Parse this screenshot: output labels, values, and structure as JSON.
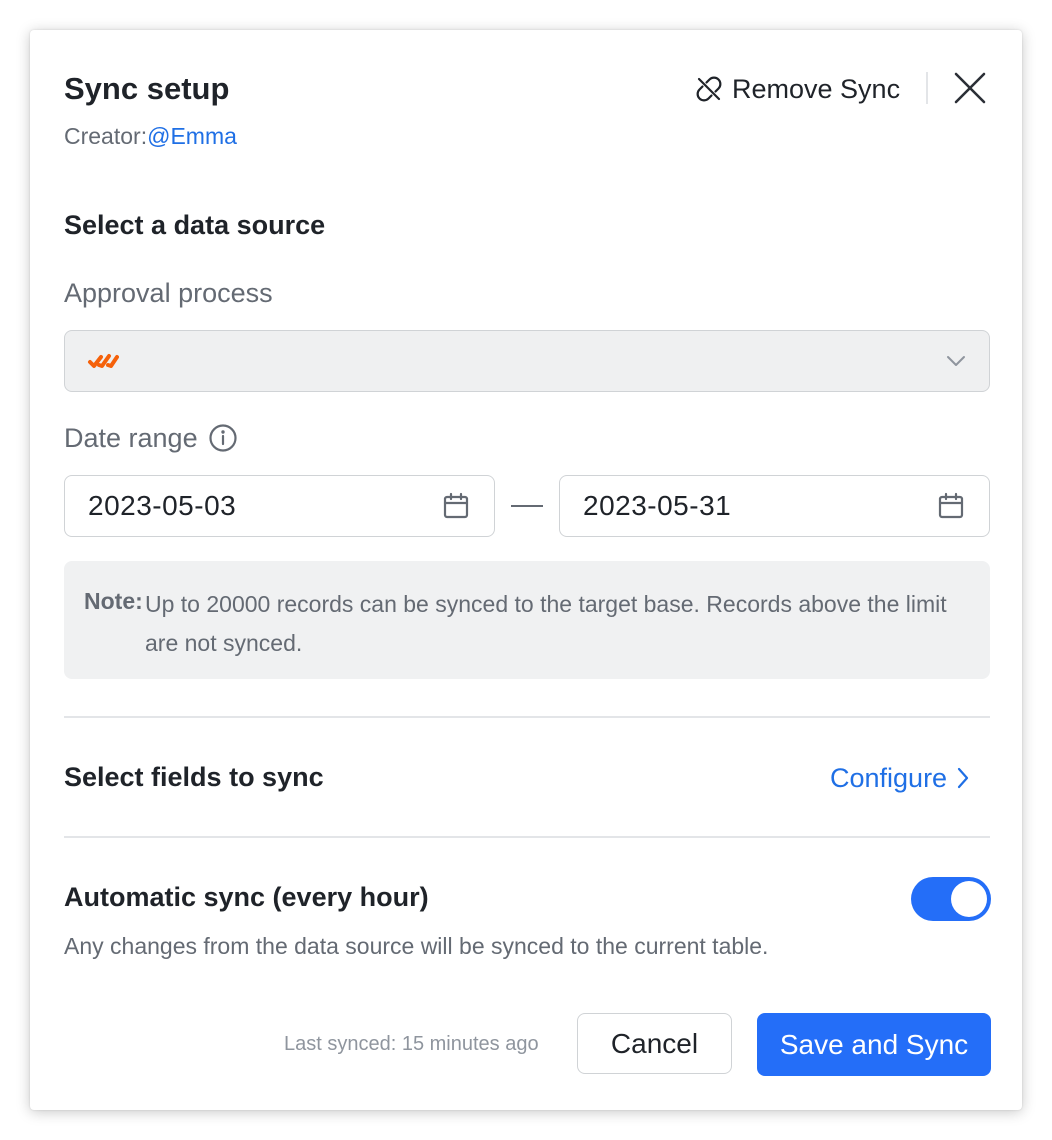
{
  "dialog": {
    "title": "Sync setup",
    "creator_prefix": "Creator:",
    "creator_name": "@Emma",
    "remove_sync_label": "Remove Sync"
  },
  "data_source": {
    "heading": "Select a data source",
    "approval_label": "Approval process",
    "selected_value": "",
    "date_range_label": "Date range",
    "start_date": "2023-05-03",
    "end_date": "2023-05-31",
    "note_label": "Note:",
    "note_text": "Up to 20000 records can be synced to the target base. Records above the limit are not synced."
  },
  "fields": {
    "heading": "Select fields to sync",
    "configure_label": "Configure"
  },
  "auto_sync": {
    "heading": "Automatic sync (every hour)",
    "enabled": true,
    "description": "Any changes from the data source will be synced to the current table."
  },
  "footer": {
    "last_synced": "Last synced: 15 minutes ago",
    "cancel_label": "Cancel",
    "save_label": "Save and Sync"
  },
  "icons": {
    "remove": "unlink-icon",
    "close": "close-icon",
    "approval_app": "approval-app-icon",
    "dropdown": "chevron-down-icon",
    "info": "info-icon",
    "calendar": "calendar-icon",
    "configure_arrow": "chevron-right-icon"
  },
  "colors": {
    "accent": "#246ef8",
    "link": "#1f6fe5",
    "app_icon": "#f5610a"
  }
}
